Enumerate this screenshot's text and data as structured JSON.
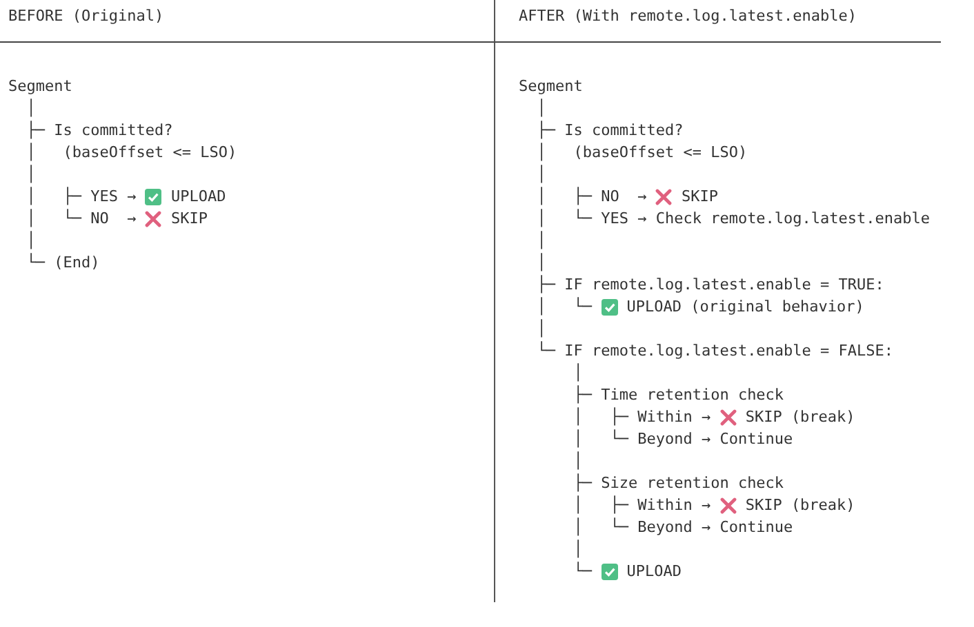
{
  "panels": [
    {
      "title": "BEFORE (Original)",
      "lines": [
        {
          "text": "Segment"
        },
        {
          "text": "  │"
        },
        {
          "text": "  ├─ Is committed?"
        },
        {
          "text": "  │   (baseOffset <= LSO)"
        },
        {
          "text": "  │"
        },
        {
          "text": "  │   ├─ YES → ",
          "kind": "upload",
          "after": " UPLOAD"
        },
        {
          "text": "  │   └─ NO  → ",
          "kind": "skip",
          "after": " SKIP"
        },
        {
          "text": "  │"
        },
        {
          "text": "  └─ (End)"
        }
      ]
    },
    {
      "title": "AFTER (With remote.log.latest.enable)",
      "lines": [
        {
          "text": "Segment"
        },
        {
          "text": "  │"
        },
        {
          "text": "  ├─ Is committed?"
        },
        {
          "text": "  │   (baseOffset <= LSO)"
        },
        {
          "text": "  │"
        },
        {
          "text": "  │   ├─ NO  → ",
          "kind": "skip",
          "after": " SKIP"
        },
        {
          "text": "  │   └─ YES → Check remote.log.latest.enable"
        },
        {
          "text": "  │"
        },
        {
          "text": "  │"
        },
        {
          "text": "  ├─ IF remote.log.latest.enable = TRUE:"
        },
        {
          "text": "  │   └─ ",
          "kind": "upload",
          "after": " UPLOAD (original behavior)"
        },
        {
          "text": "  │"
        },
        {
          "text": "  └─ IF remote.log.latest.enable = FALSE:"
        },
        {
          "text": "      │"
        },
        {
          "text": "      ├─ Time retention check"
        },
        {
          "text": "      │   ├─ Within → ",
          "kind": "skip",
          "after": " SKIP (break)"
        },
        {
          "text": "      │   └─ Beyond → Continue"
        },
        {
          "text": "      │"
        },
        {
          "text": "      ├─ Size retention check"
        },
        {
          "text": "      │   ├─ Within → ",
          "kind": "skip",
          "after": " SKIP (break)"
        },
        {
          "text": "      │   └─ Beyond → Continue"
        },
        {
          "text": "      │"
        },
        {
          "text": "      └─ ",
          "kind": "upload",
          "after": " UPLOAD"
        }
      ]
    }
  ]
}
